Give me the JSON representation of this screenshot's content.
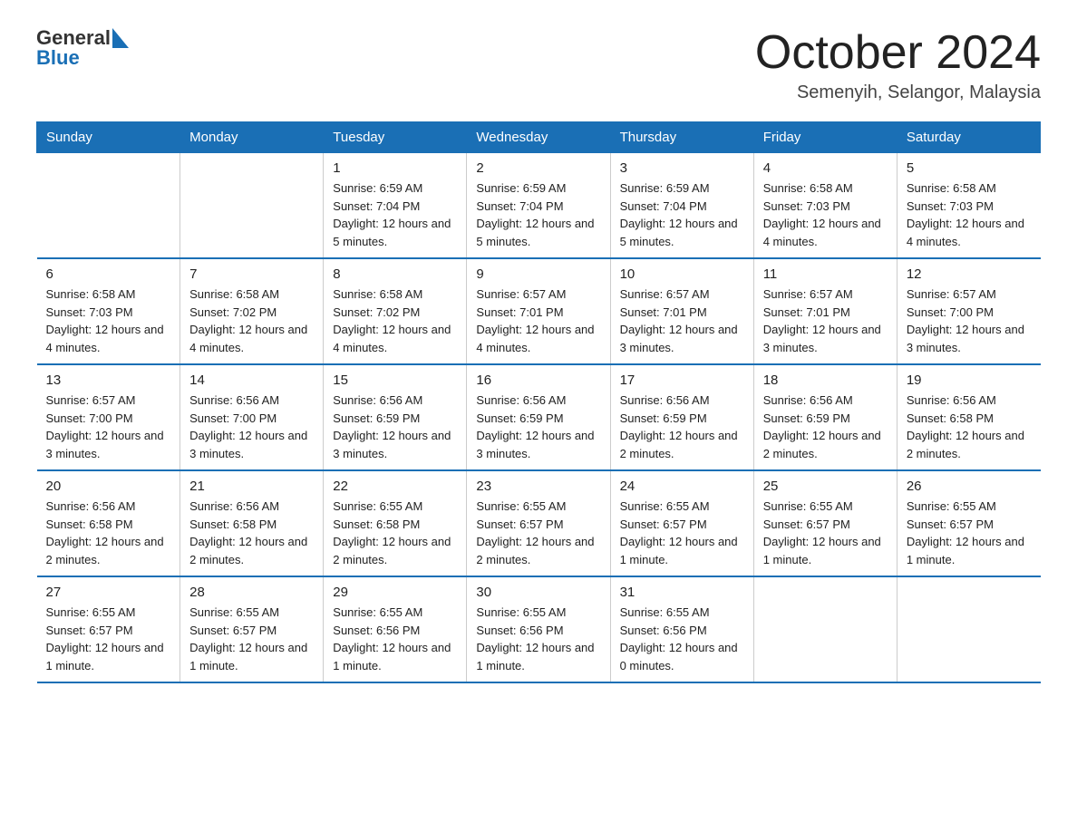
{
  "header": {
    "logo": {
      "general": "General",
      "blue": "Blue"
    },
    "month": "October 2024",
    "location": "Semenyih, Selangor, Malaysia"
  },
  "days_of_week": [
    "Sunday",
    "Monday",
    "Tuesday",
    "Wednesday",
    "Thursday",
    "Friday",
    "Saturday"
  ],
  "weeks": [
    [
      {
        "day": "",
        "info": ""
      },
      {
        "day": "",
        "info": ""
      },
      {
        "day": "1",
        "info": "Sunrise: 6:59 AM\nSunset: 7:04 PM\nDaylight: 12 hours and 5 minutes."
      },
      {
        "day": "2",
        "info": "Sunrise: 6:59 AM\nSunset: 7:04 PM\nDaylight: 12 hours and 5 minutes."
      },
      {
        "day": "3",
        "info": "Sunrise: 6:59 AM\nSunset: 7:04 PM\nDaylight: 12 hours and 5 minutes."
      },
      {
        "day": "4",
        "info": "Sunrise: 6:58 AM\nSunset: 7:03 PM\nDaylight: 12 hours and 4 minutes."
      },
      {
        "day": "5",
        "info": "Sunrise: 6:58 AM\nSunset: 7:03 PM\nDaylight: 12 hours and 4 minutes."
      }
    ],
    [
      {
        "day": "6",
        "info": "Sunrise: 6:58 AM\nSunset: 7:03 PM\nDaylight: 12 hours and 4 minutes."
      },
      {
        "day": "7",
        "info": "Sunrise: 6:58 AM\nSunset: 7:02 PM\nDaylight: 12 hours and 4 minutes."
      },
      {
        "day": "8",
        "info": "Sunrise: 6:58 AM\nSunset: 7:02 PM\nDaylight: 12 hours and 4 minutes."
      },
      {
        "day": "9",
        "info": "Sunrise: 6:57 AM\nSunset: 7:01 PM\nDaylight: 12 hours and 4 minutes."
      },
      {
        "day": "10",
        "info": "Sunrise: 6:57 AM\nSunset: 7:01 PM\nDaylight: 12 hours and 3 minutes."
      },
      {
        "day": "11",
        "info": "Sunrise: 6:57 AM\nSunset: 7:01 PM\nDaylight: 12 hours and 3 minutes."
      },
      {
        "day": "12",
        "info": "Sunrise: 6:57 AM\nSunset: 7:00 PM\nDaylight: 12 hours and 3 minutes."
      }
    ],
    [
      {
        "day": "13",
        "info": "Sunrise: 6:57 AM\nSunset: 7:00 PM\nDaylight: 12 hours and 3 minutes."
      },
      {
        "day": "14",
        "info": "Sunrise: 6:56 AM\nSunset: 7:00 PM\nDaylight: 12 hours and 3 minutes."
      },
      {
        "day": "15",
        "info": "Sunrise: 6:56 AM\nSunset: 6:59 PM\nDaylight: 12 hours and 3 minutes."
      },
      {
        "day": "16",
        "info": "Sunrise: 6:56 AM\nSunset: 6:59 PM\nDaylight: 12 hours and 3 minutes."
      },
      {
        "day": "17",
        "info": "Sunrise: 6:56 AM\nSunset: 6:59 PM\nDaylight: 12 hours and 2 minutes."
      },
      {
        "day": "18",
        "info": "Sunrise: 6:56 AM\nSunset: 6:59 PM\nDaylight: 12 hours and 2 minutes."
      },
      {
        "day": "19",
        "info": "Sunrise: 6:56 AM\nSunset: 6:58 PM\nDaylight: 12 hours and 2 minutes."
      }
    ],
    [
      {
        "day": "20",
        "info": "Sunrise: 6:56 AM\nSunset: 6:58 PM\nDaylight: 12 hours and 2 minutes."
      },
      {
        "day": "21",
        "info": "Sunrise: 6:56 AM\nSunset: 6:58 PM\nDaylight: 12 hours and 2 minutes."
      },
      {
        "day": "22",
        "info": "Sunrise: 6:55 AM\nSunset: 6:58 PM\nDaylight: 12 hours and 2 minutes."
      },
      {
        "day": "23",
        "info": "Sunrise: 6:55 AM\nSunset: 6:57 PM\nDaylight: 12 hours and 2 minutes."
      },
      {
        "day": "24",
        "info": "Sunrise: 6:55 AM\nSunset: 6:57 PM\nDaylight: 12 hours and 1 minute."
      },
      {
        "day": "25",
        "info": "Sunrise: 6:55 AM\nSunset: 6:57 PM\nDaylight: 12 hours and 1 minute."
      },
      {
        "day": "26",
        "info": "Sunrise: 6:55 AM\nSunset: 6:57 PM\nDaylight: 12 hours and 1 minute."
      }
    ],
    [
      {
        "day": "27",
        "info": "Sunrise: 6:55 AM\nSunset: 6:57 PM\nDaylight: 12 hours and 1 minute."
      },
      {
        "day": "28",
        "info": "Sunrise: 6:55 AM\nSunset: 6:57 PM\nDaylight: 12 hours and 1 minute."
      },
      {
        "day": "29",
        "info": "Sunrise: 6:55 AM\nSunset: 6:56 PM\nDaylight: 12 hours and 1 minute."
      },
      {
        "day": "30",
        "info": "Sunrise: 6:55 AM\nSunset: 6:56 PM\nDaylight: 12 hours and 1 minute."
      },
      {
        "day": "31",
        "info": "Sunrise: 6:55 AM\nSunset: 6:56 PM\nDaylight: 12 hours and 0 minutes."
      },
      {
        "day": "",
        "info": ""
      },
      {
        "day": "",
        "info": ""
      }
    ]
  ]
}
